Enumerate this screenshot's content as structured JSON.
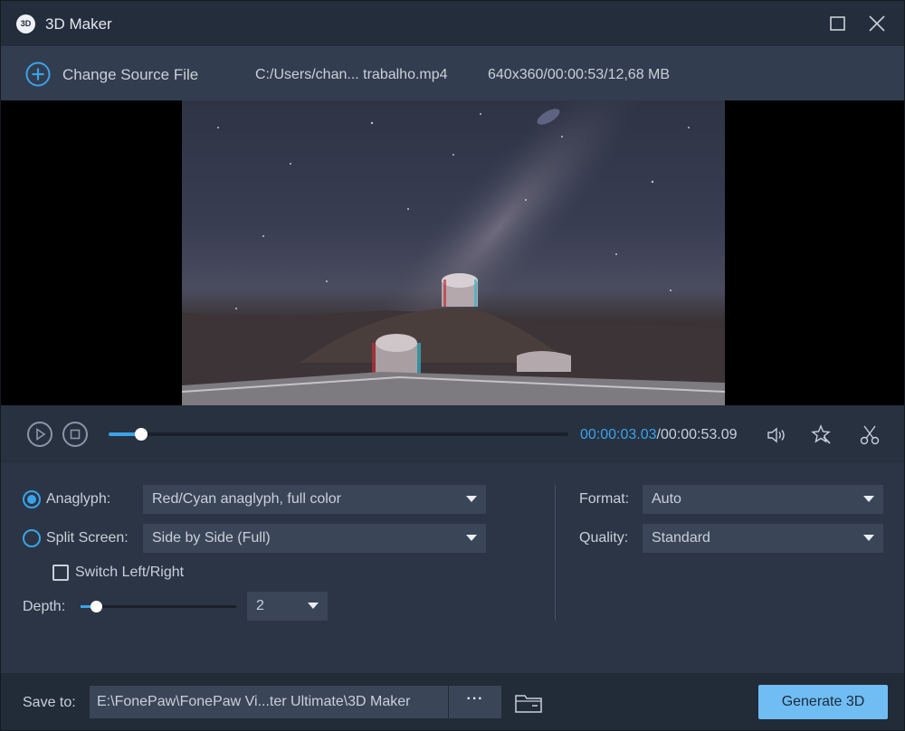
{
  "window": {
    "title": "3D Maker",
    "icon_text": "3D"
  },
  "source": {
    "change_label": "Change Source File",
    "file_name": "C:/Users/chan... trabalho.mp4",
    "file_info": "640x360/00:00:53/12,68 MB"
  },
  "player": {
    "current_time": "00:00:03.03",
    "total_time": "/00:00:53.09",
    "progress_fraction": 0.07
  },
  "settings": {
    "anaglyph_label": "Anaglyph:",
    "anaglyph_value": "Red/Cyan anaglyph, full color",
    "anaglyph_selected": true,
    "split_label": "Split Screen:",
    "split_value": "Side by Side (Full)",
    "switch_label": "Switch Left/Right",
    "switch_checked": false,
    "depth_label": "Depth:",
    "depth_value": "2",
    "depth_fraction": 0.1,
    "format_label": "Format:",
    "format_value": "Auto",
    "quality_label": "Quality:",
    "quality_value": "Standard"
  },
  "footer": {
    "save_label": "Save to:",
    "save_path": "E:\\FonePaw\\FonePaw Vi...ter Ultimate\\3D Maker",
    "browse_label": "···",
    "generate_label": "Generate 3D"
  },
  "colors": {
    "accent": "#3aa3ea",
    "generate_button": "#6fbdf3",
    "panel": "#2b3545"
  }
}
